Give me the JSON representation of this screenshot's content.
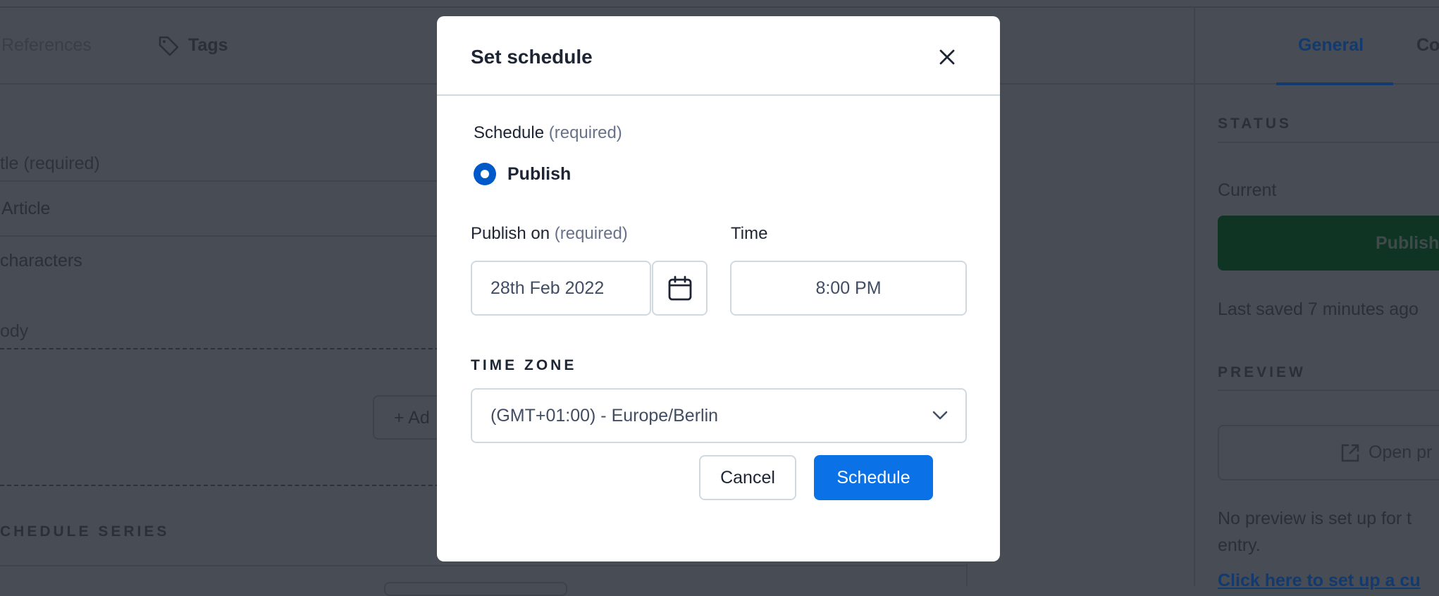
{
  "background": {
    "tabs": [
      {
        "label": "References"
      },
      {
        "label": "Tags",
        "icon": "tag-icon"
      }
    ],
    "fields": {
      "title_label": "tle (required)",
      "title_value": "Article",
      "char_count": "characters",
      "body_label": "ody",
      "add_button": "+ Ad",
      "schedule_series": "CHEDULE SERIES"
    },
    "sidebar": {
      "tabs": [
        {
          "label": "General",
          "active": true
        },
        {
          "label": "Co"
        }
      ],
      "status_heading": "STATUS",
      "current_label": "Current",
      "publish_button": "Publish",
      "last_saved": "Last saved 7 minutes ago",
      "preview_heading": "PREVIEW",
      "open_preview_button": "Open pr",
      "no_preview_text": "No preview is set up for t",
      "no_preview_text_2": "entry.",
      "setup_link": "Click here to set up a cu"
    }
  },
  "modal": {
    "title": "Set schedule",
    "close_icon": "close-icon",
    "schedule_label": "Schedule",
    "schedule_required": "(required)",
    "radio_option": "Publish",
    "radio_selected": true,
    "publish_on_label": "Publish on",
    "publish_on_required": "(required)",
    "date_value": "28th Feb 2022",
    "calendar_icon": "calendar-icon",
    "time_label": "Time",
    "time_value": "8:00 PM",
    "timezone_label": "TIME ZONE",
    "timezone_value": "(GMT+01:00) - Europe/Berlin",
    "cancel_label": "Cancel",
    "schedule_label_btn": "Schedule"
  },
  "colors": {
    "accent": "#0a72e6",
    "overlay": "#474c55",
    "radio": "#0059c8"
  }
}
